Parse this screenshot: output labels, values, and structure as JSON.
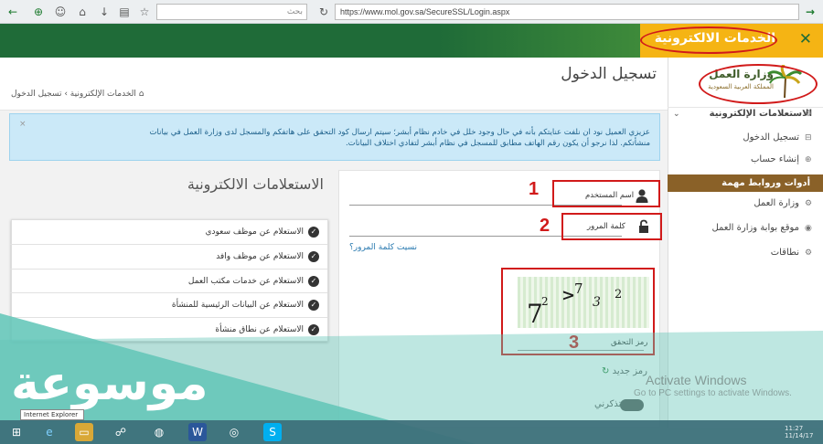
{
  "browser": {
    "search_placeholder": "بحث",
    "url": "https://www.mol.gov.sa/SecureSSL/Login.aspx"
  },
  "header": {
    "eservices_label": "الخدمات الالكترونية",
    "close_icon": "close-icon"
  },
  "sidebar": {
    "logo_title": "وزارة العمل",
    "logo_subtitle": "المملكة العربية السعودية",
    "items": [
      {
        "label": "الاستعلامات الإلكترونية",
        "icon": "gear-icon"
      },
      {
        "label": "تسجيل الدخول",
        "icon": "login-icon"
      },
      {
        "label": "إنشاء حساب",
        "icon": "add-icon"
      }
    ],
    "tools_header": "أدوات وروابط مهمة",
    "links": [
      {
        "label": "وزارة العمل",
        "icon": "gear-icon"
      },
      {
        "label": "موقع بوابة وزارة العمل",
        "icon": "globe-icon"
      },
      {
        "label": "نطاقات",
        "icon": "gear-icon"
      }
    ]
  },
  "main": {
    "page_title": "تسجيل الدخول",
    "breadcrumb": "الخدمات الإلكترونية › تسجيل الدخول",
    "alert": "عزيزي العميل نود ان نلفت عنايتكم بأنه في حال وجود خلل في خادم نظام أبشر؛ سيتم ارسال كود التحقق على هاتفكم والمسجل لدى وزارة العمل في بيانات منشأتكم. لذا نرجو أن يكون رقم الهاتف مطابق للمسجل في نظام أبشر لتفادي اختلاف البيانات.",
    "alert_close": "×"
  },
  "login": {
    "username_label": "اسم المستخدم",
    "password_label": "كلمة المرور",
    "forgot_label": "نسيت كلمة المرور؟",
    "captcha_label": "رمز التحقق",
    "captcha_text": "7 2 > 7 3 2",
    "refresh_label": "رمز جديد",
    "remember_label": "تذكرني",
    "markers": [
      "1",
      "2",
      "3"
    ]
  },
  "inquiries": {
    "title": "الاستعلامات الالكترونية",
    "items": [
      "الاستعلام عن موظف سعودي",
      "الاستعلام عن موظف وافد",
      "الاستعلام عن خدمات مكتب العمل",
      "الاستعلام عن البيانات الرئيسية للمنشأة",
      "الاستعلام عن نطاق منشأة"
    ]
  },
  "overlay": {
    "site_logo": "موسوعة",
    "activate_title": "Activate Windows",
    "activate_sub": "Go to PC settings to activate Windows.",
    "tooltip": "Internet Explorer",
    "clock_time": "11:27",
    "clock_date": "11/14/17"
  },
  "colors": {
    "header_green": "#1f6b38",
    "accent_yellow": "#f5b414",
    "tools_brown": "#8a6128",
    "annotation_red": "#d11a1a",
    "teal_overlay": "#63c6b8"
  }
}
